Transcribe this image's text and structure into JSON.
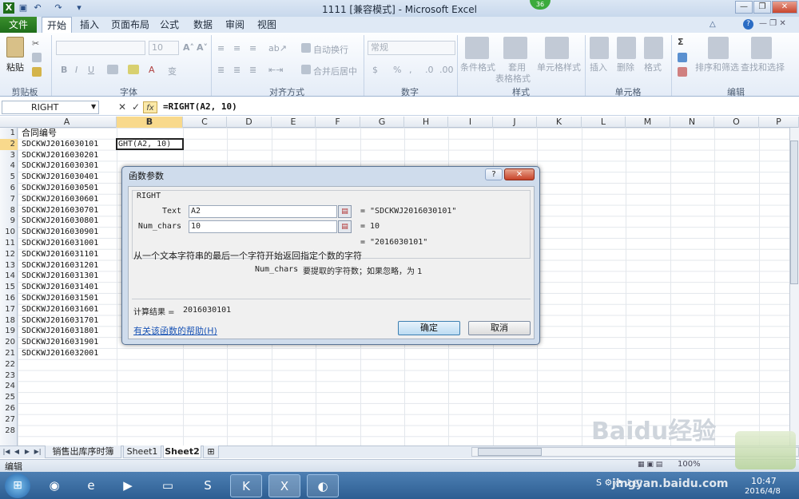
{
  "window": {
    "title": "1111 [兼容模式] - Microsoft Excel",
    "notification_count": "36"
  },
  "ribbon_tabs": [
    "文件",
    "开始",
    "插入",
    "页面布局",
    "公式",
    "数据",
    "审阅",
    "视图"
  ],
  "ribbon": {
    "paste_label": "粘贴",
    "font_size": "10",
    "wrap_text": "自动换行",
    "merge_center": "合并后居中",
    "number_format": "常规",
    "conditional_format": "条件格式",
    "table_format_1": "套用",
    "table_format_2": "表格格式",
    "cell_styles": "单元格样式",
    "insert": "插入",
    "delete": "删除",
    "format": "格式",
    "sort_filter": "排序和筛选",
    "find_select": "查找和选择",
    "groups": [
      "剪贴板",
      "字体",
      "对齐方式",
      "数字",
      "样式",
      "单元格",
      "编辑"
    ]
  },
  "formula_bar": {
    "name_box": "RIGHT",
    "cancel_icon": "✕",
    "enter_icon": "✓",
    "fx_label": "fx",
    "formula": "=RIGHT(A2, 10)"
  },
  "columns": [
    "A",
    "B",
    "C",
    "D",
    "E",
    "F",
    "G",
    "H",
    "I",
    "J",
    "K",
    "L",
    "M",
    "N",
    "O",
    "P"
  ],
  "rows": [
    "1",
    "2",
    "3",
    "4",
    "5",
    "6",
    "7",
    "8",
    "9",
    "10",
    "11",
    "12",
    "13",
    "14",
    "15",
    "16",
    "17",
    "18",
    "19",
    "20",
    "21",
    "22",
    "23",
    "24",
    "25",
    "26",
    "27",
    "28"
  ],
  "cells_a": [
    "合同编号",
    "SDCKWJ2016030101",
    "SDCKWJ2016030201",
    "SDCKWJ2016030301",
    "SDCKWJ2016030401",
    "SDCKWJ2016030501",
    "SDCKWJ2016030601",
    "SDCKWJ2016030701",
    "SDCKWJ2016030801",
    "SDCKWJ2016030901",
    "SDCKWJ2016031001",
    "SDCKWJ2016031101",
    "SDCKWJ2016031201",
    "SDCKWJ2016031301",
    "SDCKWJ2016031401",
    "SDCKWJ2016031501",
    "SDCKWJ2016031601",
    "SDCKWJ2016031701",
    "SDCKWJ2016031801",
    "SDCKWJ2016031901",
    "SDCKWJ2016032001"
  ],
  "active_cell_text": "GHT(A2, 10)",
  "dialog": {
    "title": "函数参数",
    "help_glyph": "?",
    "close_glyph": "✕",
    "function_name": "RIGHT",
    "arg1_label": "Text",
    "arg1_value": "A2",
    "arg1_result": "= \"SDCKWJ2016030101\"",
    "arg2_label": "Num_chars",
    "arg2_value": "10",
    "arg2_result": "= 10",
    "overall_result": "= \"2016030101\"",
    "description": "从一个文本字符串的最后一个字符开始返回指定个数的字符",
    "arg_help_name": "Num_chars",
    "arg_help_text": "要提取的字符数；如果忽略，为 1",
    "calc_result_label": "计算结果 =",
    "calc_result_value": "2016030101",
    "help_link": "有关该函数的帮助(H)",
    "ok": "确定",
    "cancel": "取消"
  },
  "sheet_tabs": [
    "销售出库序时簿",
    "Sheet1",
    "Sheet2"
  ],
  "status": {
    "mode": "编辑",
    "zoom": "100%"
  },
  "taskbar": {
    "time": "10:47",
    "date": "2016/4/8"
  },
  "watermark": {
    "logo": "Baidu经验",
    "url": "jingyan.baidu.com"
  }
}
